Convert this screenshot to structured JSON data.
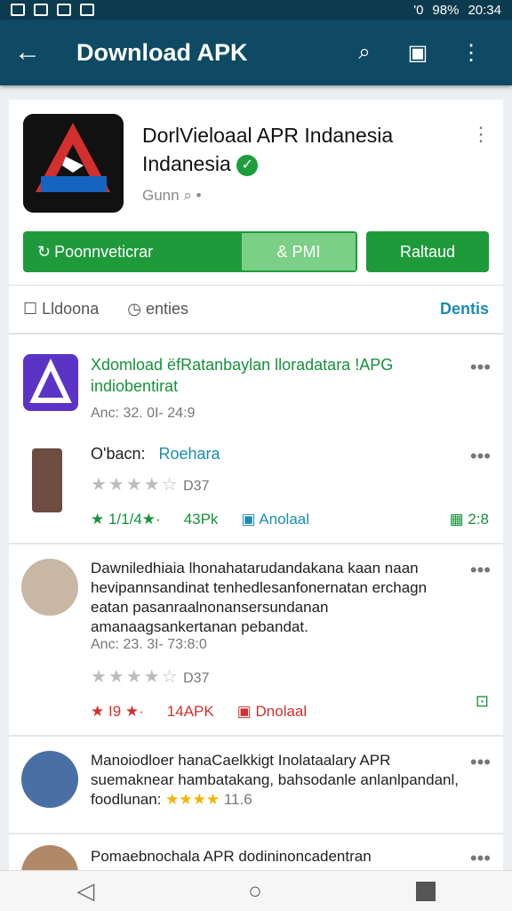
{
  "status_bar": {
    "left_icons": [
      "image-icon",
      "image-icon",
      "settings-icon",
      "notification-icon"
    ],
    "signal_text": "'0",
    "battery": "98%",
    "time": "20:34"
  },
  "appbar": {
    "title": "Download APK"
  },
  "app": {
    "title": "DorlVieloaal APR Indanesia Indanesia",
    "subtitle": "Gunn",
    "primary_button": "Poonnveticrar",
    "secondary_segment": "& PMI",
    "side_button": "Raltaud"
  },
  "tabs": {
    "left": "Lldoona",
    "middle": "enties",
    "right": "Dentis"
  },
  "items": [
    {
      "title": "Xdomload ëfRatanbaylan lloradatara !APG indiobentirat",
      "meta": "Anc: 32. 0I- 24:9",
      "sub_title": "O'bacn:",
      "sub_link": "Roehara",
      "rating_text": "D37",
      "bottom_left": "1/1/4★·",
      "size": "43Pk",
      "download": "Anolaal",
      "right_badge": "2:8"
    },
    {
      "title": "Dawniledhiaia lhonahatarudandakana kaan naan hevipannsandinat tenhedlesanfonernatan erchagn eatan pasanraalnonansersundanan amanaagsankertanan pebandat.",
      "meta": "Anc: 23. 3I- 73:8:0",
      "rating_text": "D37",
      "bottom_left": "I9 ★·",
      "size": "14APK",
      "download": "Dnolaal"
    },
    {
      "title": "Manoiodloer hanaCaelkkigt Inolataalary APR suemaknear hambatakang, bahsodanle anlanlpandanl, foodlunan:",
      "stars_text": "★★★★",
      "extra": "11.6"
    },
    {
      "title": "Pomaebnochala APR dodininoncadentran"
    }
  ],
  "colors": {
    "primary": "#0e4a63",
    "accent": "#1f9a3b",
    "link": "#1a8cb5"
  }
}
